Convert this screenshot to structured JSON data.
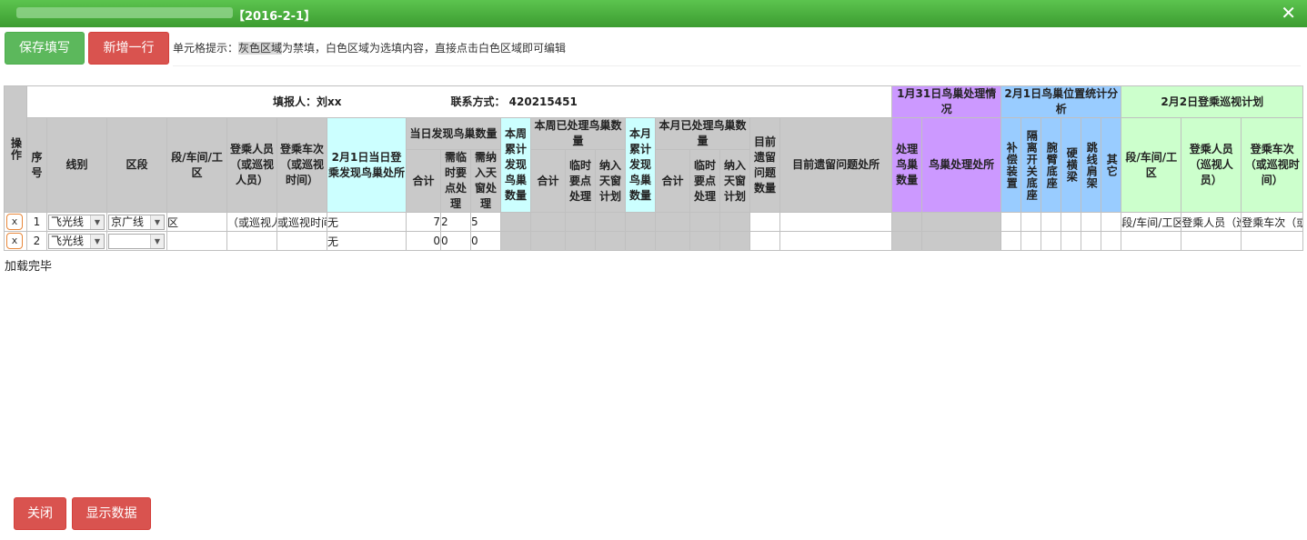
{
  "window": {
    "title_date": "【2016-2-1】",
    "close_label": "✕"
  },
  "toolbar": {
    "save_label": "保存填写",
    "add_row_label": "新增一行",
    "hint_prefix": "单元格提示：",
    "hint_gray": "灰色区域",
    "hint_rest": "为禁填，白色区域为选填内容，直接点击白色区域即可编辑"
  },
  "table": {
    "reporter": "填报人：刘xx",
    "contact": "联系方式：  420215451",
    "headers": {
      "op": "操作",
      "seq": "序号",
      "line": "线别",
      "section": "区段",
      "workshop": "段/车间/工区",
      "person": "登乘人员（或巡视人员）",
      "train": "登乘车次（或巡视时间）",
      "found_place": "2月1日当日登乘发现鸟巢处所",
      "day_found": "当日发现鸟巢数量",
      "day_total": "合计",
      "day_temp": "需临时要点处理",
      "day_window": "需纳入天窗处理",
      "week_total_found": "本周累计发现鸟巢数量",
      "week_processed": "本周已处理鸟巢数量",
      "week_p_total": "合计",
      "week_p_temp": "临时要点处理",
      "week_p_window": "纳入天窗计划",
      "month_total_found": "本月累计发现鸟巢数量",
      "month_processed": "本月已处理鸟巢数量",
      "month_p_total": "合计",
      "month_p_temp": "临时要点处理",
      "month_p_window": "纳入天窗计划",
      "remain_count": "目前遗留问题数量",
      "remain_place": "目前遗留问题处所",
      "g_jan31": "1月31日鸟巢处理情况",
      "jan31_count": "处理鸟巢数量",
      "jan31_place": "鸟巢处理处所",
      "g_feb1": "2月1日鸟巢位置统计分析",
      "feb1_a": "补偿装置",
      "feb1_b": "隔离开关底座",
      "feb1_c": "腕臂底座",
      "feb1_d": "硬横梁",
      "feb1_e": "跳线肩架",
      "feb1_f": "其它",
      "g_feb2": "2月2日登乘巡视计划",
      "feb2_workshop": "段/车间/工区",
      "feb2_person": "登乘人员（巡视人员）",
      "feb2_train": "登乘车次（或巡视时间）"
    },
    "rows": [
      {
        "del": "x",
        "seq": "1",
        "line": "飞光线",
        "section": "京广线",
        "workshop": "区",
        "person": "（或巡视人",
        "train": "或巡视时间",
        "found_place": "无",
        "day_total": "7",
        "day_temp": "2",
        "day_window": "5",
        "feb2_workshop": "段/车间/工区",
        "feb2_person": "登乘人员（巡",
        "feb2_train": "登乘车次（或"
      },
      {
        "del": "x",
        "seq": "2",
        "line": "飞光线",
        "section": "",
        "workshop": "",
        "person": "",
        "train": "",
        "found_place": "无",
        "day_total": "0",
        "day_temp": "0",
        "day_window": "0",
        "feb2_workshop": "",
        "feb2_person": "",
        "feb2_train": ""
      }
    ]
  },
  "status": {
    "loaded": "加载完毕"
  },
  "footer": {
    "close_label": "关闭",
    "show_data_label": "显示数据"
  }
}
